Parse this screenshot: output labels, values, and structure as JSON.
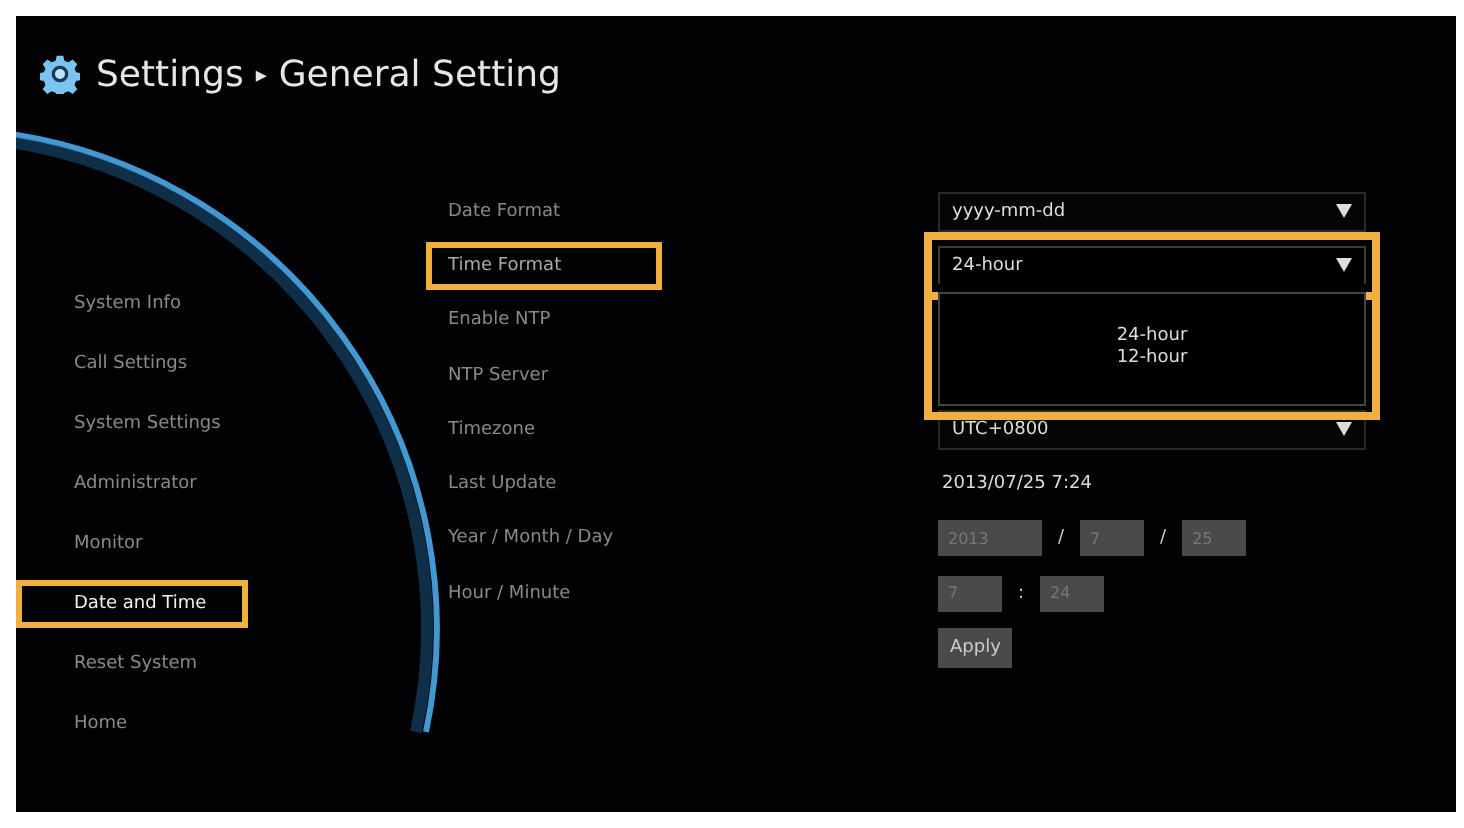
{
  "header": {
    "title": "Settings",
    "separator": "▸",
    "subtitle": "General Setting"
  },
  "sidebar": {
    "items": [
      {
        "label": "System Info",
        "selected": false,
        "highlighted": false
      },
      {
        "label": "Call Settings",
        "selected": false,
        "highlighted": false
      },
      {
        "label": "System Settings",
        "selected": false,
        "highlighted": false
      },
      {
        "label": "Administrator",
        "selected": false,
        "highlighted": false
      },
      {
        "label": "Monitor",
        "selected": false,
        "highlighted": false
      },
      {
        "label": "Date and Time",
        "selected": true,
        "highlighted": true
      },
      {
        "label": "Reset System",
        "selected": false,
        "highlighted": false
      },
      {
        "label": "Home",
        "selected": false,
        "highlighted": false
      }
    ]
  },
  "settings": [
    {
      "label": "Date Format",
      "highlighted": false,
      "kind": "dropdown",
      "value": "yyyy-mm-dd"
    },
    {
      "label": "Time Format",
      "highlighted": true,
      "kind": "dropdown",
      "value": "24-hour",
      "expanded": true,
      "options": [
        "24-hour",
        "12-hour"
      ]
    },
    {
      "label": "Enable NTP",
      "highlighted": false,
      "kind": "hidden"
    },
    {
      "label": "NTP Server",
      "highlighted": false,
      "kind": "hidden"
    },
    {
      "label": "Timezone",
      "highlighted": false,
      "kind": "dropdown",
      "value": "UTC+0800"
    },
    {
      "label": "Last Update",
      "highlighted": false,
      "kind": "text",
      "value": "2013/07/25 7:24"
    },
    {
      "label": "Year / Month / Day",
      "highlighted": false,
      "kind": "fields",
      "separator": "/",
      "fields": [
        "2013",
        "7",
        "25"
      ]
    },
    {
      "label": "Hour / Minute",
      "highlighted": false,
      "kind": "fields",
      "separator": ":",
      "fields": [
        "7",
        "24"
      ]
    }
  ],
  "apply_button": "Apply"
}
